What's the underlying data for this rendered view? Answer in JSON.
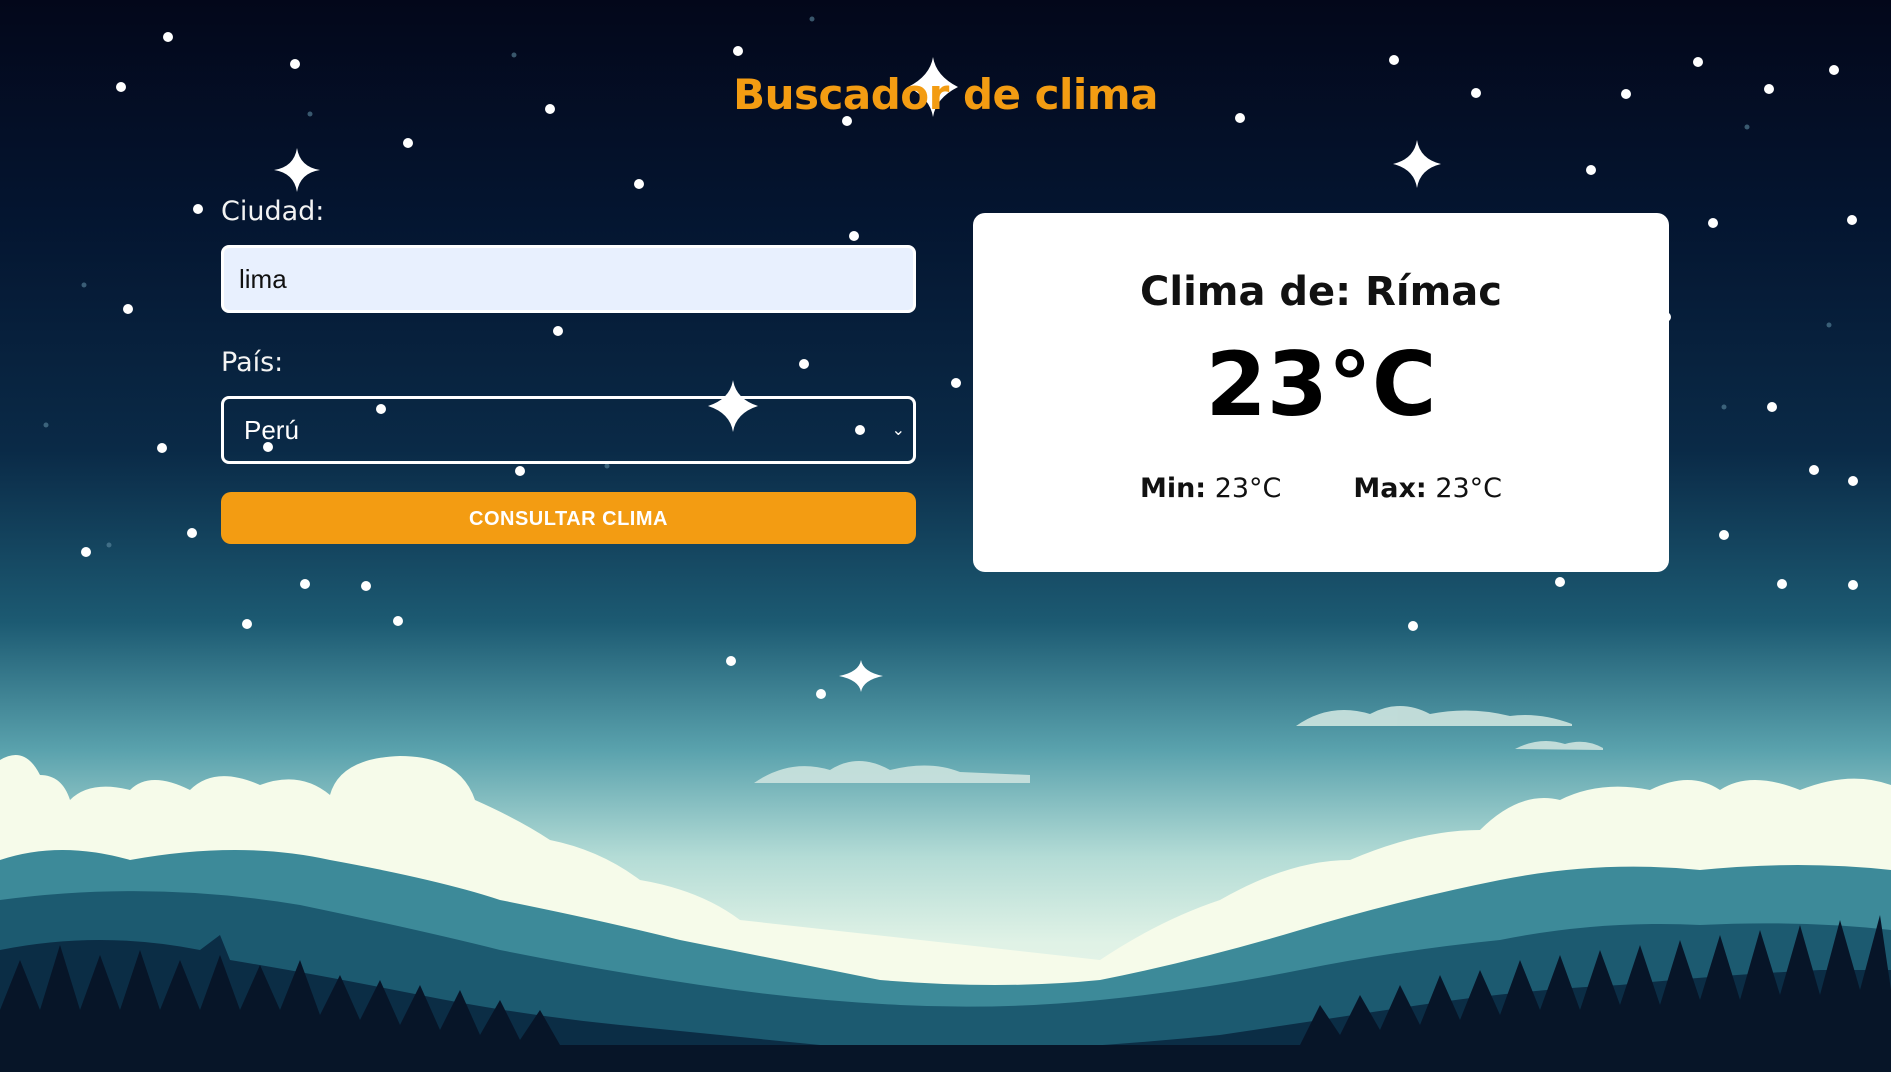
{
  "app": {
    "title": "Buscador de clima"
  },
  "form": {
    "city_label": "Ciudad:",
    "city_value": "lima",
    "country_label": "País:",
    "country_selected": "Perú",
    "submit_label": "CONSULTAR CLIMA"
  },
  "result": {
    "title": "Clima de: Rímac",
    "temperature": "23°C",
    "min_label": "Min:",
    "min_value": "23°C",
    "max_label": "Max:",
    "max_value": "23°C"
  },
  "colors": {
    "accent": "#f39c12",
    "sky_top": "#03071a",
    "card": "#ffffff",
    "input_bg": "#e8f0fe"
  },
  "icons": {
    "select_caret": "chevron-down-icon"
  }
}
